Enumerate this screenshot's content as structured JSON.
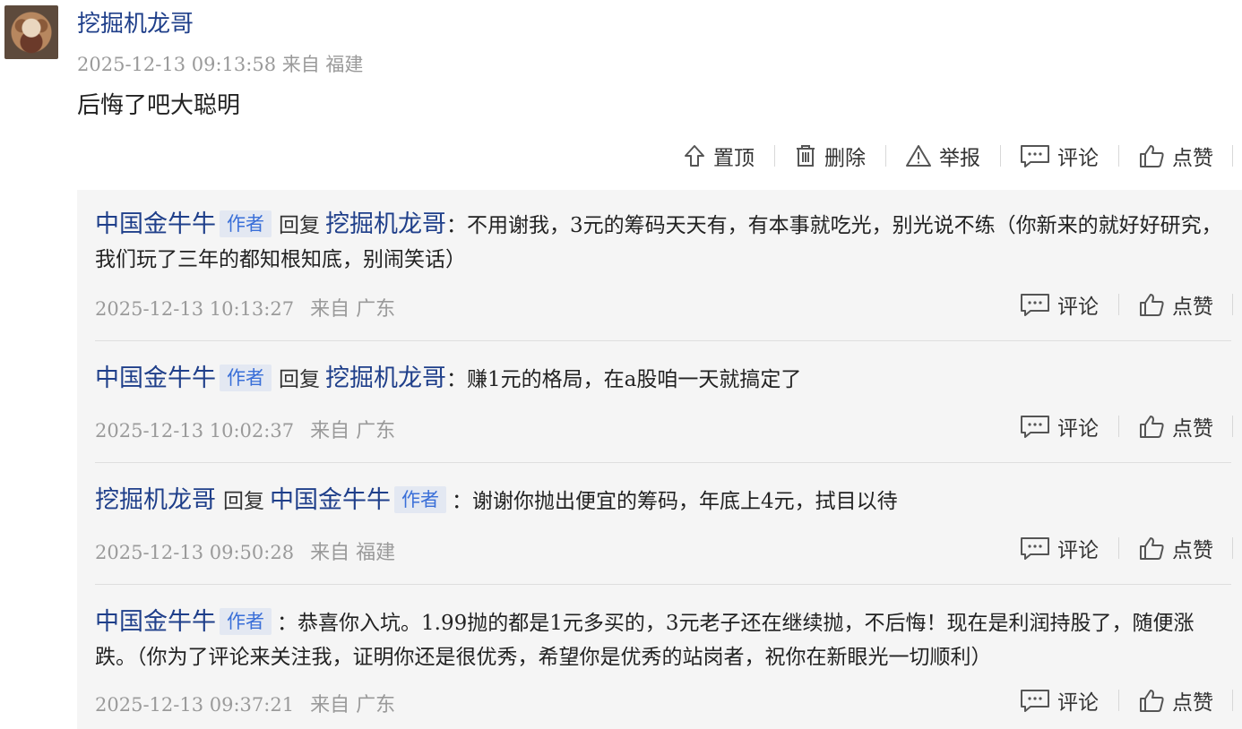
{
  "post": {
    "author": "挖掘机龙哥",
    "meta": "2025-12-13 09:13:58 来自 福建",
    "content": "后悔了吧大聪明",
    "actions": {
      "pin": "置顶",
      "delete": "删除",
      "report": "举报",
      "comment": "评论",
      "like": "点赞"
    }
  },
  "replies": [
    {
      "user": "中国金牛牛",
      "tag": "作者",
      "verb": "回复",
      "target": "挖掘机龙哥",
      "target_tag": "",
      "text": "：不用谢我，3元的筹码天天有，有本事就吃光，别光说不练（你新来的就好好研究，我们玩了三年的都知根知底，别闹笑话）",
      "time": "2025-12-13 10:13:27",
      "location": "来自 广东",
      "comment": "评论",
      "like": "点赞"
    },
    {
      "user": "中国金牛牛",
      "tag": "作者",
      "verb": "回复",
      "target": "挖掘机龙哥",
      "target_tag": "",
      "text": "：赚1元的格局，在a股咱一天就搞定了",
      "time": "2025-12-13 10:02:37",
      "location": "来自 广东",
      "comment": "评论",
      "like": "点赞"
    },
    {
      "user": "挖掘机龙哥",
      "tag": "",
      "verb": "回复",
      "target": "中国金牛牛",
      "target_tag": "作者",
      "text": "：谢谢你抛出便宜的筹码，年底上4元，拭目以待",
      "time": "2025-12-13 09:50:28",
      "location": "来自 福建",
      "comment": "评论",
      "like": "点赞"
    },
    {
      "user": "中国金牛牛",
      "tag": "作者",
      "verb": "",
      "target": "",
      "target_tag": "",
      "text": "：恭喜你入坑。1.99抛的都是1元多买的，3元老子还在继续抛，不后悔！现在是利润持股了，随便涨跌。（你为了评论来关注我，证明你还是很优秀，希望你是优秀的站岗者，祝你在新眼光一切顺利）",
      "time": "2025-12-13 09:37:21",
      "location": "来自 广东",
      "comment": "评论",
      "like": "点赞"
    }
  ]
}
